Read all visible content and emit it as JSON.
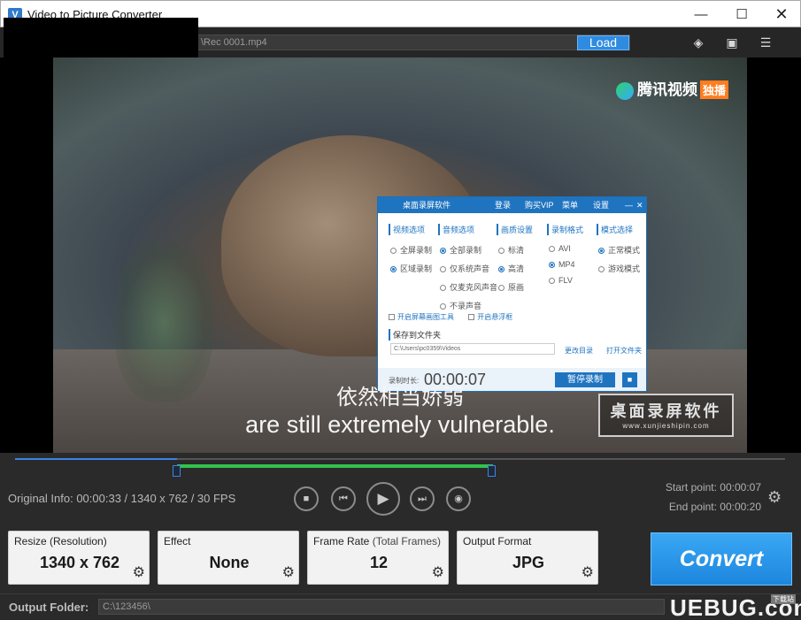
{
  "window": {
    "title": "Video to Picture Converter",
    "minimize": "—",
    "maximize": "☐",
    "close": "✕",
    "app_icon": "V"
  },
  "toolbar": {
    "path": "\\Rec 0001.mp4",
    "load_label": "Load",
    "icons": [
      "tag-icon",
      "chat-icon",
      "list-icon"
    ]
  },
  "video": {
    "logo_text": "腾讯视频",
    "logo_tag": "独播",
    "subtitle_cn": "依然相当娇弱",
    "subtitle_en": "are still extremely vulnerable.",
    "watermark_title": "桌面录屏软件",
    "watermark_url": "www.xunjieshipin.com"
  },
  "recorder": {
    "title": "桌面录屏软件",
    "login": "登录",
    "vip": "购买VIP",
    "menu": "菜单",
    "settings": "设置",
    "columns": [
      {
        "header": "视频选项",
        "options": [
          {
            "label": "全屏录制",
            "on": false
          },
          {
            "label": "区域录制",
            "on": true
          }
        ]
      },
      {
        "header": "音频选项",
        "options": [
          {
            "label": "全部录制",
            "on": true
          },
          {
            "label": "仅系统声音",
            "on": false
          },
          {
            "label": "仅麦克风声音",
            "on": false
          },
          {
            "label": "不录声音",
            "on": false
          }
        ]
      },
      {
        "header": "画质设置",
        "options": [
          {
            "label": "标清",
            "on": false
          },
          {
            "label": "高清",
            "on": true
          },
          {
            "label": "原画",
            "on": false
          }
        ]
      },
      {
        "header": "录制格式",
        "options": [
          {
            "label": "AVI",
            "on": false
          },
          {
            "label": "MP4",
            "on": true
          },
          {
            "label": "FLV",
            "on": false
          }
        ]
      },
      {
        "header": "模式选择",
        "options": [
          {
            "label": "正常模式",
            "on": true
          },
          {
            "label": "游戏模式",
            "on": false
          }
        ]
      }
    ],
    "check1": "开启屏幕画图工具",
    "check2": "开启悬浮框",
    "save_label": "保存到文件夹",
    "save_path": "C:\\Users\\pc0359\\Videos",
    "change_dir": "更改目录",
    "open_dir": "打开文件夹",
    "duration_label": "录制时长:",
    "timer": "00:00:07",
    "pause_label": "暂停录制"
  },
  "timeline": {
    "original_info": "Original Info: 00:00:33 / 1340 x 762 / 30 FPS",
    "start_point": "Start point: 00:00:07",
    "end_point": "End point: 00:00:20",
    "played_fraction": 0.21,
    "selection": {
      "start": 0.21,
      "end": 0.62
    }
  },
  "cards": [
    {
      "title": "Resize (Resolution)",
      "sub": "",
      "value": "1340 x 762"
    },
    {
      "title": "Effect",
      "sub": "",
      "value": "None"
    },
    {
      "title": "Frame Rate",
      "sub": " (Total Frames)",
      "value": "12"
    },
    {
      "title": "Output Format",
      "sub": "",
      "value": "JPG"
    }
  ],
  "convert_label": "Convert",
  "output": {
    "label": "Output Folder:",
    "path": "C:\\123456\\"
  },
  "brand": {
    "text": "UEBUG.com",
    "tag": "下载站"
  }
}
